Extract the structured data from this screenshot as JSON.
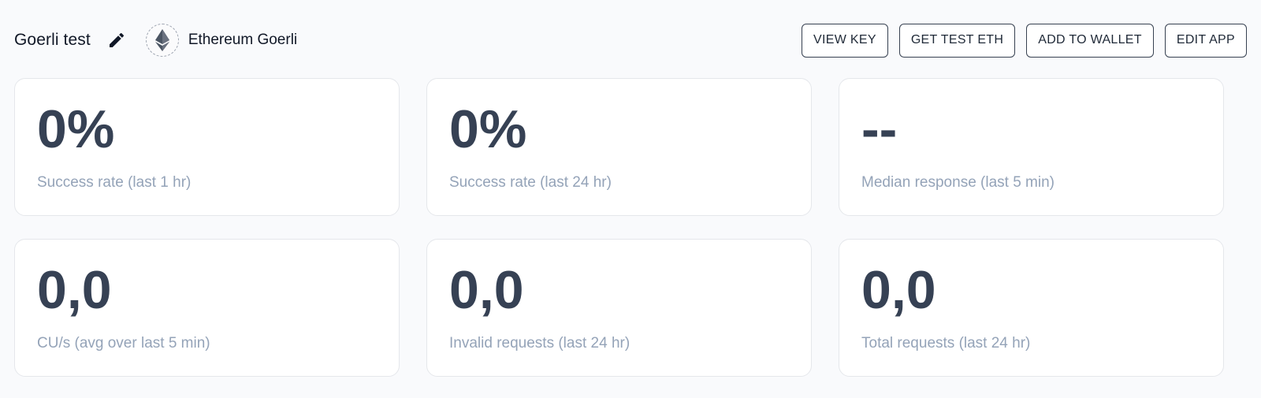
{
  "header": {
    "app_name": "Goerli test",
    "edit_icon": "pencil-icon",
    "network": {
      "icon": "ethereum-icon",
      "name": "Ethereum Goerli"
    },
    "actions": [
      {
        "label": "VIEW KEY"
      },
      {
        "label": "GET TEST ETH"
      },
      {
        "label": "ADD TO WALLET"
      },
      {
        "label": "EDIT APP"
      }
    ]
  },
  "stats": [
    {
      "value": "0%",
      "label": "Success rate (last 1 hr)"
    },
    {
      "value": "0%",
      "label": "Success rate (last 24 hr)"
    },
    {
      "value": "--",
      "label": "Median response (last 5 min)"
    },
    {
      "value": "0,0",
      "label": "CU/s (avg over last 5 min)"
    },
    {
      "value": "0,0",
      "label": "Invalid requests (last 24 hr)"
    },
    {
      "value": "0,0",
      "label": "Total requests (last 24 hr)"
    }
  ],
  "colors": {
    "background": "#f9fafc",
    "card_value": "#364154",
    "card_label": "#94a3b8",
    "button_border": "#374151"
  }
}
